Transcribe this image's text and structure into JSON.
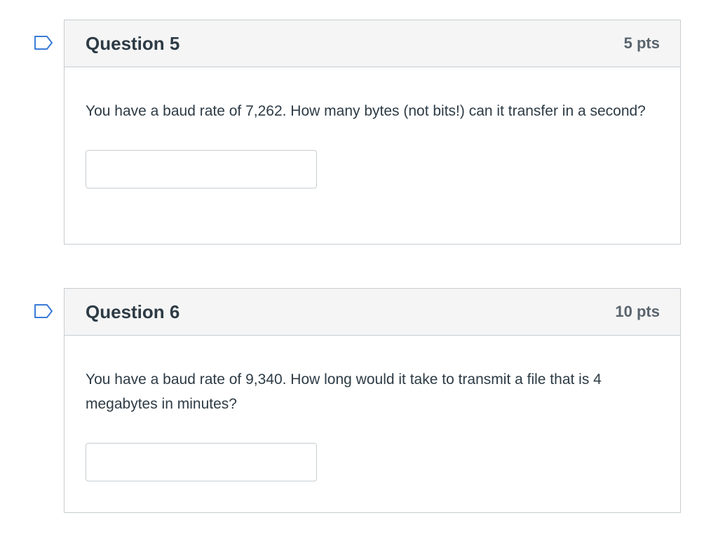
{
  "questions": [
    {
      "title": "Question 5",
      "points": "5 pts",
      "text": "You have a baud rate of 7,262. How many bytes (not bits!) can it transfer in a second?",
      "answer_value": "",
      "answer_placeholder": ""
    },
    {
      "title": "Question 6",
      "points": "10 pts",
      "text": "You have a baud rate of 9,340. How long would it take to transmit a file that is 4 megabytes in minutes?",
      "answer_value": "",
      "answer_placeholder": ""
    }
  ],
  "icons": {
    "flag": "flag-question-icon"
  },
  "colors": {
    "flag_outline": "#3b7bd8",
    "header_bg": "#f5f5f5",
    "border": "#c7cdd1",
    "text": "#2d3b45",
    "points_text": "#59646d"
  }
}
